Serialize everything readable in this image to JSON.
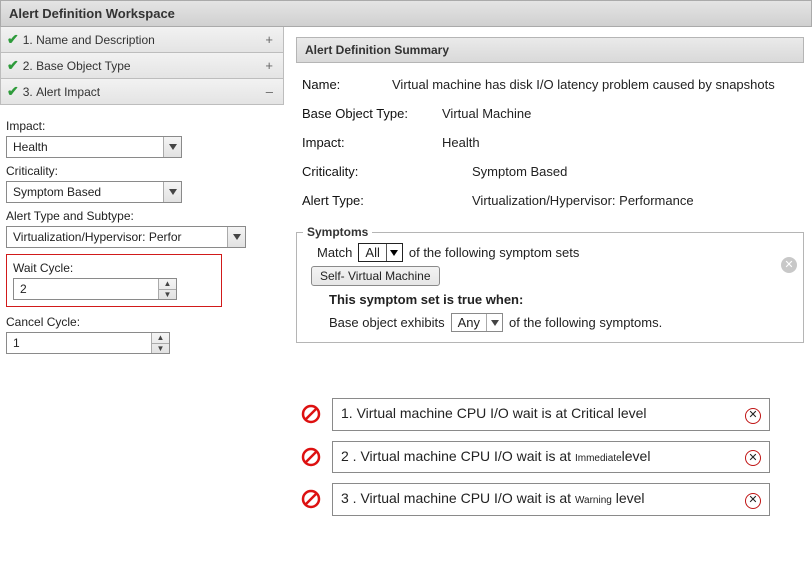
{
  "workspace": {
    "title": "Alert Definition Workspace"
  },
  "steps": [
    {
      "num": "1.",
      "label": "Name and Description",
      "toggle": "+"
    },
    {
      "num": "2.",
      "label": "Base Object Type",
      "toggle": "+"
    },
    {
      "num": "3.",
      "label": "Alert Impact",
      "toggle": "–"
    }
  ],
  "form": {
    "impact_label": "Impact:",
    "impact_value": "Health",
    "criticality_label": "Criticality:",
    "criticality_value": "Symptom Based",
    "type_label": "Alert Type and Subtype:",
    "type_value": "Virtualization/Hypervisor: Perfor",
    "wait_label": "Wait Cycle:",
    "wait_value": "2",
    "cancel_label": "Cancel Cycle:",
    "cancel_value": "1"
  },
  "summary": {
    "header": "Alert Definition Summary",
    "name_k": "Name:",
    "name_v": "Virtual machine has disk I/O latency problem caused by snapshots",
    "bot_k": "Base Object Type:",
    "bot_v": "Virtual Machine",
    "impact_k": "Impact:",
    "impact_v": "Health",
    "crit_k": "Criticality:",
    "crit_v": "Symptom Based",
    "atype_k": "Alert Type:",
    "atype_v": "Virtualization/Hypervisor: Performance"
  },
  "symptoms": {
    "legend": "Symptoms",
    "match_lead": "Match",
    "match_value": "All",
    "match_tail": "of the following symptom sets",
    "tab": "Self- Virtual Machine",
    "set_title": "This symptom set is true when:",
    "set_lead": "Base object exhibits",
    "set_value": "Any",
    "set_tail": "of the following symptoms."
  },
  "symptom_list": [
    {
      "num": "1.",
      "pre": "Virtual machine CPU I/O wait is at Critical level"
    },
    {
      "num": "2 .",
      "pre": "Virtual machine CPU I/O wait is at",
      "sev": "Immediate",
      "post": "level"
    },
    {
      "num": "3 .",
      "pre": "Virtual machine CPU I/O wait is at",
      "sev": "Warning",
      "post": "level"
    }
  ]
}
